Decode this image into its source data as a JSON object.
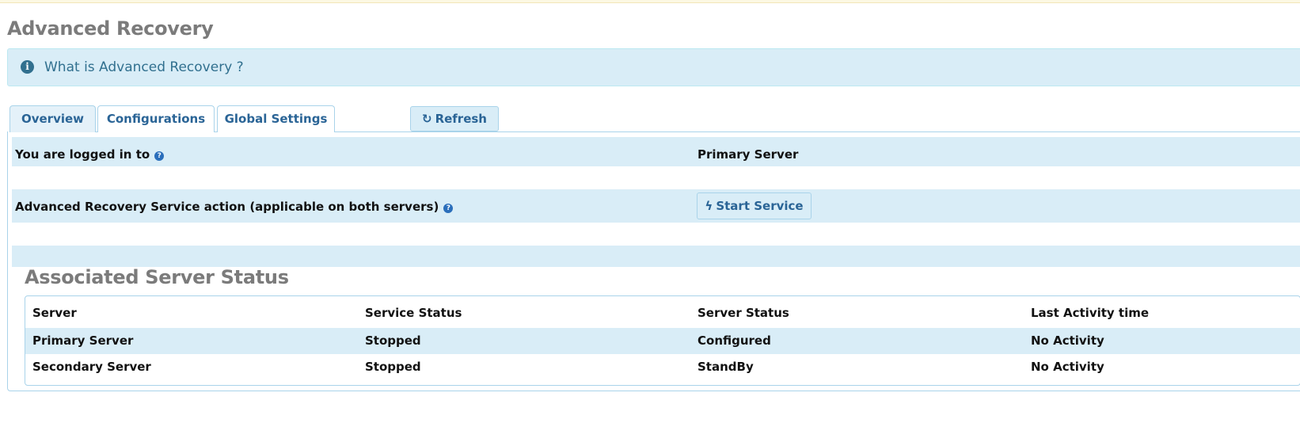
{
  "page": {
    "title": "Advanced Recovery"
  },
  "info": {
    "icon": "info-circle-icon",
    "text": "What is Advanced Recovery ?"
  },
  "tabs": [
    {
      "label": "Overview",
      "active": true
    },
    {
      "label": "Configurations",
      "active": false
    },
    {
      "label": "Global Settings",
      "active": false
    }
  ],
  "toolbar": {
    "refresh_label": "Refresh",
    "refresh_icon": "refresh-icon"
  },
  "overview": {
    "logged_in_label": "You are logged in to",
    "logged_in_value": "Primary Server",
    "service_action_label": "Advanced Recovery Service action (applicable on both servers)",
    "start_service_label": "Start Service",
    "start_service_icon": "bolt-icon"
  },
  "status_section": {
    "title": "Associated Server Status",
    "columns": [
      "Server",
      "Service Status",
      "Server Status",
      "Last Activity time"
    ],
    "rows": [
      [
        "Primary Server",
        "Stopped",
        "Configured",
        "No Activity"
      ],
      [
        "Secondary Server",
        "Stopped",
        "StandBy",
        "No Activity"
      ]
    ]
  },
  "colors": {
    "accent": "#2a6496",
    "info_bg": "#d9edf7",
    "border": "#a9d3ea",
    "title_gray": "#7b7b7b"
  }
}
